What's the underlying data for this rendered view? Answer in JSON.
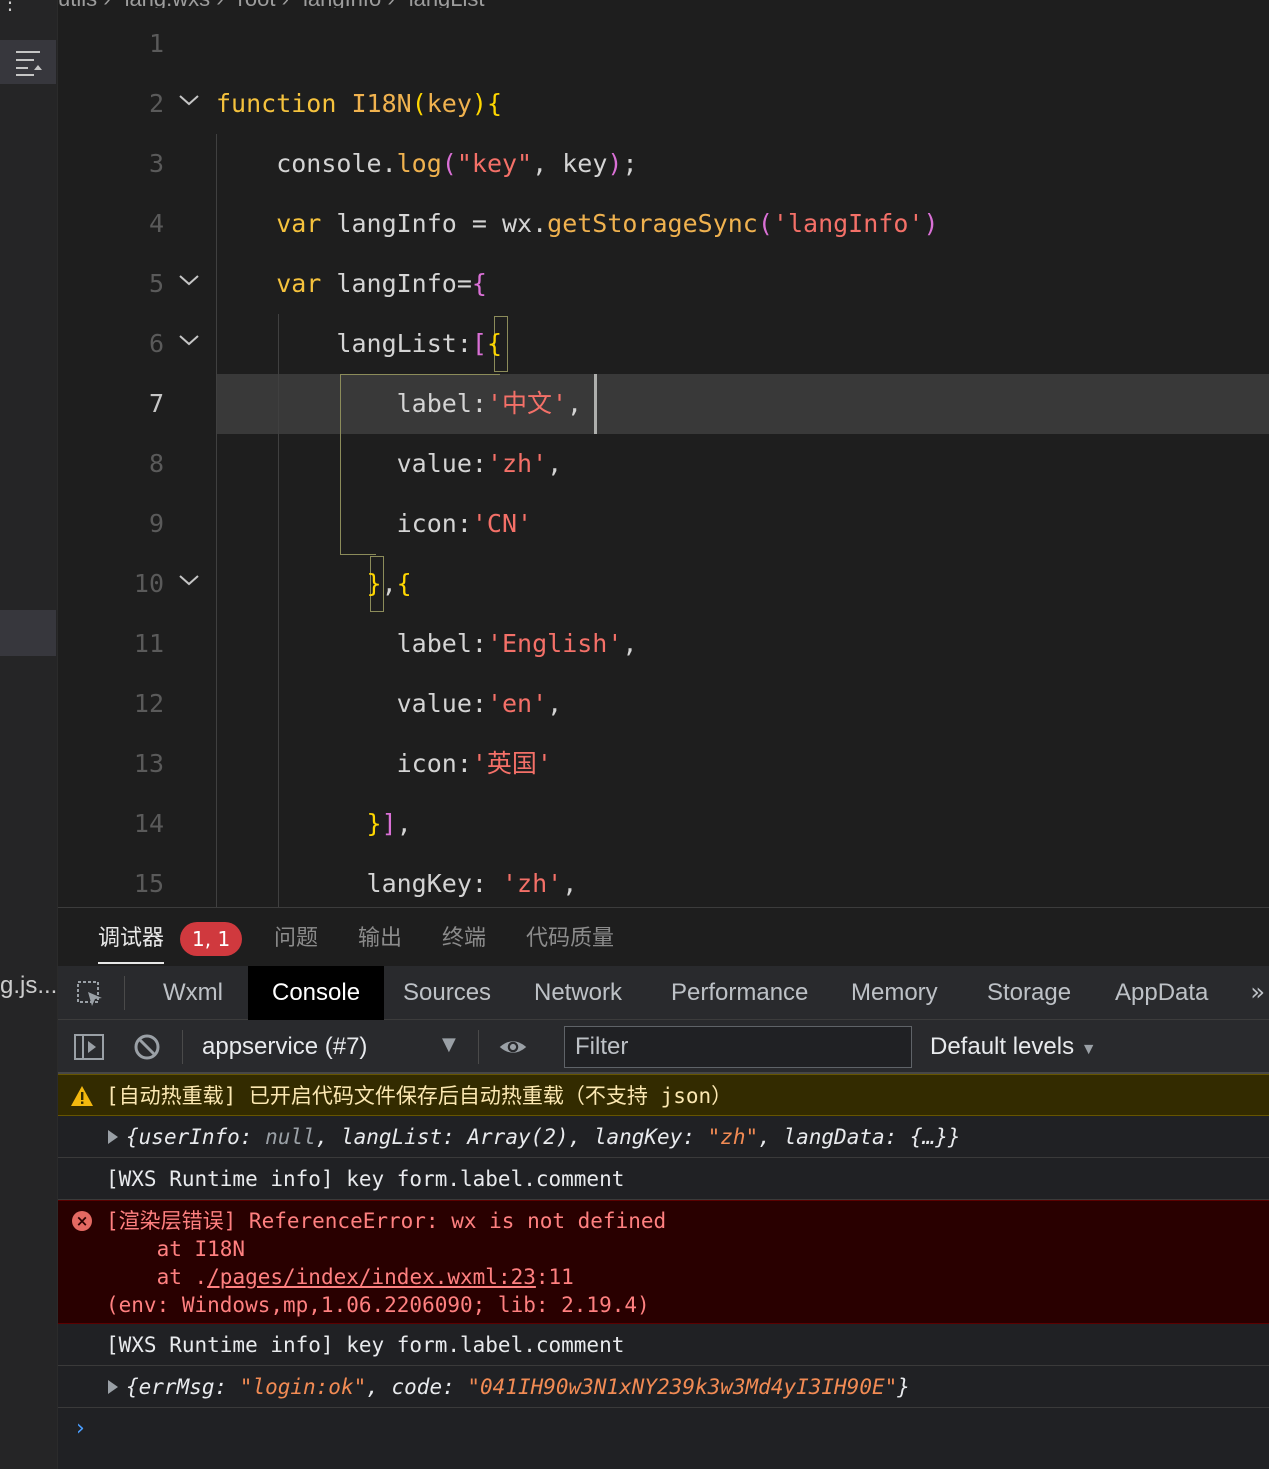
{
  "left_strip": {
    "file_fragment": "g.js..."
  },
  "breadcrumb": [
    "utils",
    "lang.wxs",
    "root",
    "langInfo",
    "langList"
  ],
  "editor": {
    "current_line": 7,
    "lines": [
      {
        "n": "1",
        "tokens": []
      },
      {
        "n": "2",
        "tokens": [
          [
            "kw",
            "function "
          ],
          [
            "fn",
            "I18N"
          ],
          [
            "br1",
            "("
          ],
          [
            "fn",
            "key"
          ],
          [
            "br1",
            "){"
          ]
        ]
      },
      {
        "n": "3",
        "tokens": [
          [
            "pun",
            "    console."
          ],
          [
            "fn",
            "log"
          ],
          [
            "br2",
            "("
          ],
          [
            "str",
            "\"key\""
          ],
          [
            "pun",
            ", key"
          ],
          [
            "br2",
            ")"
          ],
          [
            "pun",
            ";"
          ]
        ]
      },
      {
        "n": "4",
        "tokens": [
          [
            "kw",
            "    var "
          ],
          [
            "pun",
            "langInfo = wx."
          ],
          [
            "fn",
            "getStorageSync"
          ],
          [
            "br2",
            "("
          ],
          [
            "str",
            "'langInfo'"
          ],
          [
            "br2",
            ")"
          ]
        ]
      },
      {
        "n": "5",
        "tokens": [
          [
            "kw",
            "    var "
          ],
          [
            "pun",
            "langInfo="
          ],
          [
            "br2",
            "{"
          ]
        ]
      },
      {
        "n": "6",
        "tokens": [
          [
            "pun",
            "        langList:"
          ],
          [
            "br2",
            "["
          ],
          [
            "br1",
            "{"
          ]
        ]
      },
      {
        "n": "7",
        "tokens": [
          [
            "pun",
            "            label:"
          ],
          [
            "str",
            "'中文'"
          ],
          [
            "pun",
            ","
          ]
        ]
      },
      {
        "n": "8",
        "tokens": [
          [
            "pun",
            "            value:"
          ],
          [
            "str",
            "'zh'"
          ],
          [
            "pun",
            ","
          ]
        ]
      },
      {
        "n": "9",
        "tokens": [
          [
            "pun",
            "            icon:"
          ],
          [
            "str",
            "'CN'"
          ]
        ]
      },
      {
        "n": "10",
        "tokens": [
          [
            "br1",
            "          }"
          ],
          [
            "pun",
            ","
          ],
          [
            "br1",
            "{"
          ]
        ]
      },
      {
        "n": "11",
        "tokens": [
          [
            "pun",
            "            label:"
          ],
          [
            "str",
            "'English'"
          ],
          [
            "pun",
            ","
          ]
        ]
      },
      {
        "n": "12",
        "tokens": [
          [
            "pun",
            "            value:"
          ],
          [
            "str",
            "'en'"
          ],
          [
            "pun",
            ","
          ]
        ]
      },
      {
        "n": "13",
        "tokens": [
          [
            "pun",
            "            icon:"
          ],
          [
            "str",
            "'英国'"
          ]
        ]
      },
      {
        "n": "14",
        "tokens": [
          [
            "br1",
            "          }"
          ],
          [
            "br2",
            "]"
          ],
          [
            "pun",
            ","
          ]
        ]
      },
      {
        "n": "15",
        "tokens": [
          [
            "pun",
            "          langKey: "
          ],
          [
            "str",
            "'zh'"
          ],
          [
            "pun",
            ","
          ]
        ]
      }
    ]
  },
  "panel_tabs": {
    "debugger": "调试器",
    "badge": "1, 1",
    "problems": "问题",
    "output": "输出",
    "terminal": "终端",
    "code_quality": "代码质量"
  },
  "devtools_tabs": [
    "Wxml",
    "Console",
    "Sources",
    "Network",
    "Performance",
    "Memory",
    "Storage",
    "AppData"
  ],
  "devtools_active_tab": "Console",
  "console_toolbar": {
    "context": "appservice (#7)",
    "filter_placeholder": "Filter",
    "levels": "Default levels"
  },
  "console": {
    "warning": "[自动热重载] 已开启代码文件保存后自动热重载（不支持 json）",
    "obj1": {
      "brace_open": "{",
      "k1": "userInfo: ",
      "v1": "null",
      "k2": ", langList: Array(2), langKey: ",
      "v2": "\"zh\"",
      "k3": ", langData: {…}}"
    },
    "info1": "[WXS Runtime info] key form.label.comment",
    "error": {
      "line1": "[渲染层错误] ReferenceError: wx is not defined",
      "line2": "    at I18N",
      "line3_prefix": "    at .",
      "line3_link": "/pages/index/index.wxml:23",
      "line3_suffix": ":11",
      "line4": "(env: Windows,mp,1.06.2206090; lib: 2.19.4)"
    },
    "info2": "[WXS Runtime info] key form.label.comment",
    "obj2": {
      "k1": "{errMsg: ",
      "v1": "\"login:ok\"",
      "k2": ", code: ",
      "v2": "\"041IH90w3N1xNY239k3w3Md4yI3IH90E\"",
      "k3": "}"
    }
  },
  "colors": {
    "keyword": "#f5c23d",
    "string": "#f47068",
    "bracket_pink": "#da70d6",
    "error_bg": "#290000",
    "warn_bg": "#332b00",
    "badge_red": "#d0393e"
  }
}
